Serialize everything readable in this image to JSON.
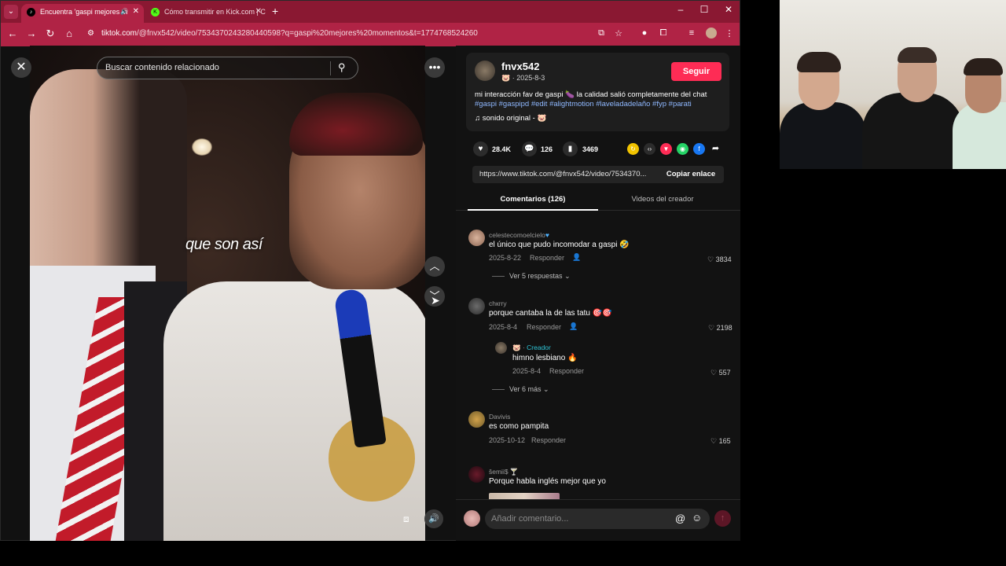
{
  "browser": {
    "tabs": [
      {
        "label": "Encuentra 'gaspi mejores m",
        "favicon": "tiktok-icon",
        "active": true
      },
      {
        "label": "Cómo transmitir en Kick.com | C",
        "favicon": "kick-icon",
        "active": false
      }
    ],
    "url_domain": "tiktok.com",
    "url_rest": "/@fnvx542/video/7534370243280440598?q=gaspi%20mejores%20momentos&t=1774768524260",
    "accent_color": "#b02345"
  },
  "video": {
    "search_placeholder": "Buscar contenido relacionado",
    "caption": "que son así"
  },
  "post": {
    "author": "fnvx542",
    "date": "· 2025-8-3",
    "follow_label": "Seguir",
    "description": "mi interacción fav de gaspi 🍆 la calidad salió completamente del chat",
    "hashtags": "#gaspi #gaspipd #edit #alightmotion #laveladadelaño #fyp #parati",
    "music": "sonido original - ",
    "likes": "28.4K",
    "comments": "126",
    "saves": "3469",
    "link": "https://www.tiktok.com/@fnvx542/video/7534370...",
    "copy_label": "Copiar enlace"
  },
  "tabs": {
    "comments": "Comentarios (126)",
    "creator_videos": "Videos del creador"
  },
  "comments": [
    {
      "user": "celestecomoelcielo",
      "text": "el único que pudo incomodar a gaspi 🤣",
      "date": "2025-8-22",
      "reply": "Responder",
      "likes": "3834",
      "more": "Ver 5 respuestas"
    },
    {
      "user": "chкrry",
      "text": "porque cantaba la de las tatu 🎯🎯",
      "date": "2025-8-4",
      "reply": "Responder",
      "likes": "2198"
    },
    {
      "user": "Creador",
      "text": "himno lesbiano 🔥",
      "date": "2025-8-4",
      "reply": "Responder",
      "likes": "557",
      "more": "Ver 6 más"
    },
    {
      "user": "Davivis",
      "text": "es como pampita",
      "date": "2025-10-12",
      "reply": "Responder",
      "likes": "165"
    },
    {
      "user": "šemii$ 🍸",
      "text": "Porque habla inglés mejor que yo"
    }
  ],
  "comment_box": {
    "placeholder": "Añadir comentario..."
  }
}
